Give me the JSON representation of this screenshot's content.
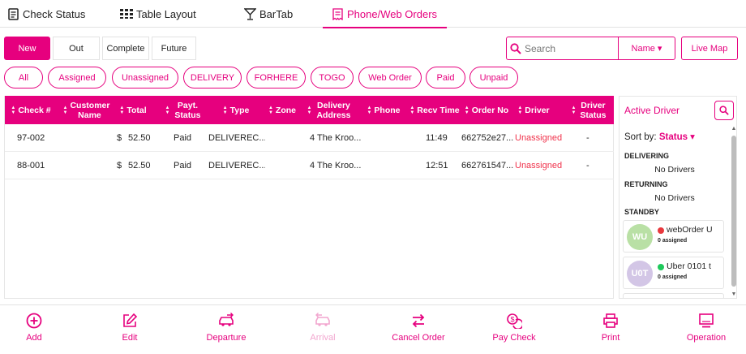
{
  "colors": {
    "accent": "#e6007e",
    "unassigned": "#f0324b",
    "driver_red": "#e8383d",
    "driver_green": "#1ec95b"
  },
  "top_tabs": [
    {
      "label": "Check Status",
      "icon": "receipt-list-icon",
      "active": false
    },
    {
      "label": "Table Layout",
      "icon": "table-grid-icon",
      "active": false
    },
    {
      "label": "BarTab",
      "icon": "cocktail-glass-icon",
      "active": false
    },
    {
      "label": "Phone/Web Orders",
      "icon": "receipt-icon",
      "active": true
    }
  ],
  "status_tabs": [
    {
      "label": "New",
      "active": true
    },
    {
      "label": "Out",
      "active": false
    },
    {
      "label": "Complete",
      "active": false
    },
    {
      "label": "Future",
      "active": false
    }
  ],
  "search": {
    "placeholder": "Search",
    "field": "Name ▾"
  },
  "live_map_label": "Live Map",
  "filters": [
    "All",
    "Assigned",
    "Unassigned",
    "DELIVERY",
    "FORHERE",
    "TOGO",
    "Web Order",
    "Paid",
    "Unpaid"
  ],
  "table": {
    "columns": [
      "Check #",
      "Customer Name",
      "Total",
      "Payt. Status",
      "Type",
      "Zone",
      "Delivery Address",
      "Phone",
      "Recv Time",
      "Order No",
      "Driver",
      "Driver Status"
    ],
    "rows": [
      {
        "check": "97-002",
        "customer": "",
        "currency": "$",
        "total": "52.50",
        "payment": "Paid",
        "type": "DELIVEREC...",
        "zone": "",
        "address": "4 The Kroo...",
        "phone": "",
        "recv": "11:49",
        "order_no": "662752e27...",
        "driver": "Unassigned",
        "driver_status": "-"
      },
      {
        "check": "88-001",
        "customer": "",
        "currency": "$",
        "total": "52.50",
        "payment": "Paid",
        "type": "DELIVEREC...",
        "zone": "",
        "address": "4 The Kroo...",
        "phone": "",
        "recv": "12:51",
        "order_no": "662761547...",
        "driver": "Unassigned",
        "driver_status": "-"
      }
    ]
  },
  "driver_panel": {
    "title": "Active Driver",
    "sort_label": "Sort by:",
    "sort_value": "Status ▾",
    "sections": [
      {
        "name": "DELIVERING",
        "empty_text": "No Drivers"
      },
      {
        "name": "RETURNING",
        "empty_text": "No Drivers"
      },
      {
        "name": "STANDBY",
        "empty_text": ""
      }
    ],
    "drivers": [
      {
        "initials": "WU",
        "name": "webOrder U",
        "assigned": "0 assigned",
        "status_color": "#e8383d",
        "avatar_color": "#b9e0a5"
      },
      {
        "initials": "U0T",
        "name": "Uber 0101 t",
        "assigned": "0 assigned",
        "status_color": "#1ec95b",
        "avatar_color": "#d3c6e6"
      }
    ]
  },
  "toolbar": [
    {
      "label": "Add",
      "icon": "add-circle-icon",
      "enabled": true
    },
    {
      "label": "Edit",
      "icon": "edit-icon",
      "enabled": true
    },
    {
      "label": "Departure",
      "icon": "departure-car-icon",
      "enabled": true
    },
    {
      "label": "Arrival",
      "icon": "arrival-car-icon",
      "enabled": false
    },
    {
      "label": "Cancel Order",
      "icon": "swap-arrows-icon",
      "enabled": true
    },
    {
      "label": "Pay Check",
      "icon": "coins-icon",
      "enabled": true
    },
    {
      "label": "Print",
      "icon": "printer-icon",
      "enabled": true
    },
    {
      "label": "Operation",
      "icon": "monitor-icon",
      "enabled": true
    }
  ]
}
